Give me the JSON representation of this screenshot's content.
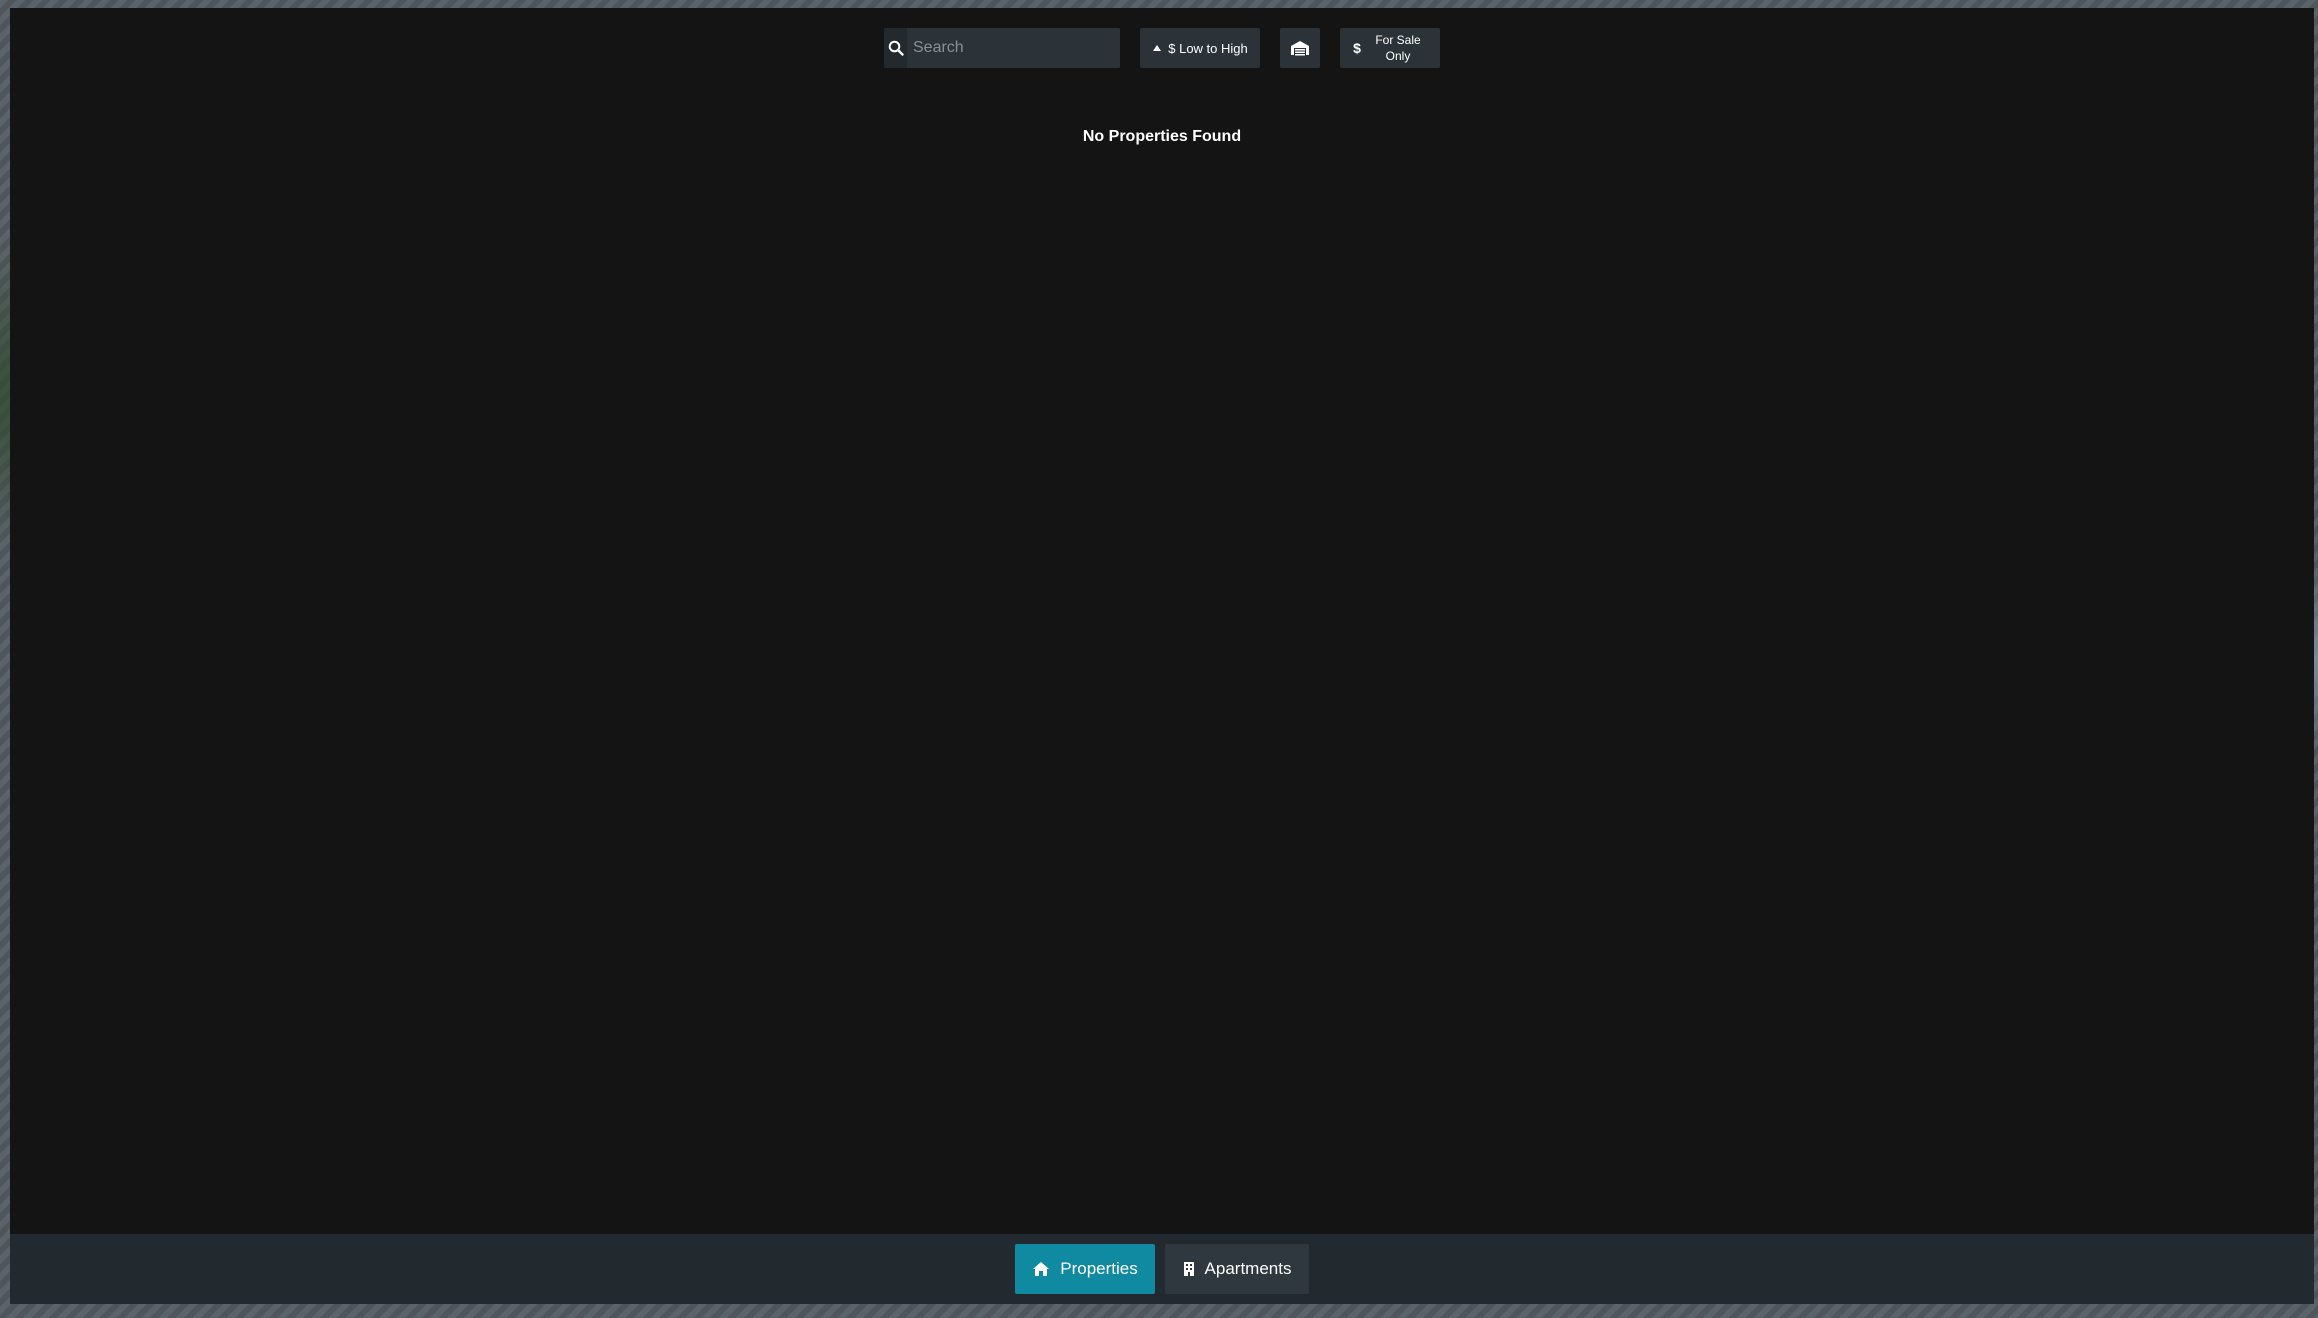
{
  "search": {
    "placeholder": "Search",
    "value": ""
  },
  "toolbar": {
    "sort_label": "$ Low to High",
    "sort_icon": "caret-up-icon",
    "garage_icon": "garage-icon",
    "sale_label": "For Sale Only",
    "sale_icon": "dollar-icon"
  },
  "main": {
    "empty_message": "No Properties Found"
  },
  "tabs": [
    {
      "label": "Properties",
      "icon": "home-icon",
      "active": true
    },
    {
      "label": "Apartments",
      "icon": "building-icon",
      "active": false
    }
  ],
  "colors": {
    "panel_bg": "#141414",
    "control_bg": "#2b3338",
    "bottom_bar_bg": "#222a30",
    "accent": "#0f8aa1"
  }
}
